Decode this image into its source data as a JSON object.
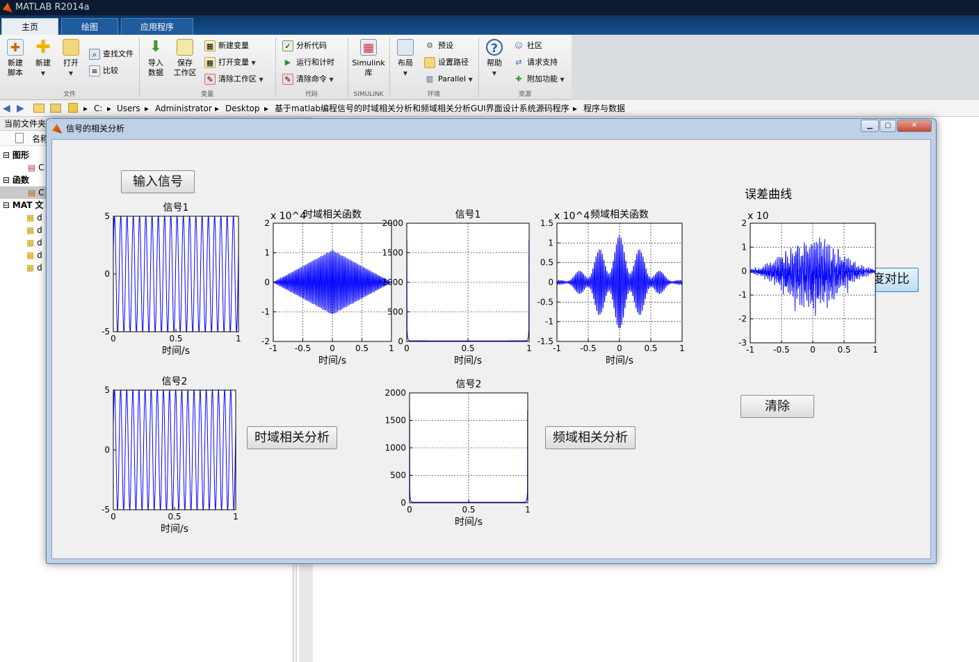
{
  "app": {
    "title": "MATLAB R2014a"
  },
  "tabs": [
    "主页",
    "绘图",
    "应用程序"
  ],
  "ribbon": {
    "file": {
      "new_script": "新建\n脚本",
      "new": "新建",
      "open": "打开",
      "find_files": "查找文件",
      "compare": "比较",
      "group": "文件"
    },
    "variable": {
      "import": "导入\n数据",
      "save_ws": "保存\n工作区",
      "new_var": "新建变量",
      "open_var": "打开变量",
      "clear_ws": "清除工作区",
      "group": "变量"
    },
    "code": {
      "analyze": "分析代码",
      "run_time": "运行和计时",
      "clear_cmd": "清除命令",
      "group": "代码"
    },
    "simulink": {
      "lib": "Simulink\n库",
      "group": "SIMULINK"
    },
    "env": {
      "layout": "布局",
      "prefs": "预设",
      "set_path": "设置路径",
      "parallel": "Parallel",
      "group": "环境"
    },
    "resources": {
      "help": "帮助",
      "community": "社区",
      "support": "请求支持",
      "addons": "附加功能",
      "group": "资源"
    }
  },
  "path": [
    "C:",
    "Users",
    "Administrator",
    "Desktop",
    "基于matlab编程信号的时域相关分析和频域相关分析GUI界面设计系统源码程序",
    "程序与数据"
  ],
  "left_panel": {
    "header": "当前文件夹",
    "col_name": "名称",
    "groups": [
      {
        "label": "图形",
        "items": [
          "C"
        ]
      },
      {
        "label": "函数",
        "items": [
          "C"
        ]
      },
      {
        "label": "MAT 文",
        "items": [
          "d",
          "d",
          "d",
          "d",
          "d"
        ]
      }
    ]
  },
  "figure": {
    "title": "信号的相关分析",
    "buttons": {
      "input": "输入信号",
      "time_corr": "时域相关分析",
      "freq_corr": "频域相关分析",
      "clear": "清除",
      "compare": "精度对比"
    },
    "error_title": "误差曲线"
  },
  "chart_data": [
    {
      "id": "sig1_time",
      "type": "line",
      "title": "信号1",
      "xlabel": "时间/s",
      "ylabel": "",
      "xlim": [
        0,
        1
      ],
      "ylim": [
        -5,
        5
      ],
      "xticks": [
        "0",
        "0.5",
        "1"
      ],
      "yticks": [
        "-5",
        "0",
        "5"
      ],
      "grid": false,
      "series": [
        {
          "kind": "sine",
          "amplitude": 5,
          "frequency": 20,
          "color": "#0000ff"
        }
      ]
    },
    {
      "id": "time_corr",
      "type": "line",
      "title": "时域相关函数",
      "multiplier": "x 10^4",
      "xlabel": "时间/s",
      "ylabel": "",
      "xlim": [
        -1,
        1
      ],
      "ylim": [
        -2,
        2
      ],
      "xticks": [
        "-1",
        "-0.5",
        "0",
        "0.5",
        "1"
      ],
      "yticks": [
        "-2",
        "-1",
        "0",
        "1",
        "2"
      ],
      "grid": true,
      "series": [
        {
          "kind": "triangle_modulated",
          "peak": 1.1,
          "frequency": 40,
          "color": "#0000ff"
        }
      ]
    },
    {
      "id": "sig1_freq",
      "type": "line",
      "title": "信号1",
      "xlabel": "时间/s",
      "ylabel": "",
      "xlim": [
        0,
        1
      ],
      "ylim": [
        0,
        2000
      ],
      "xticks": [
        "0",
        "0.5",
        "1"
      ],
      "yticks": [
        "0",
        "500",
        "1000",
        "1500",
        "2000"
      ],
      "grid": true,
      "series": [
        {
          "kind": "edge_spikes",
          "peak": 1700,
          "floor": 10,
          "color": "#0000ff"
        }
      ]
    },
    {
      "id": "freq_corr",
      "type": "line",
      "title": "频域相关函数",
      "multiplier": "x 10^4",
      "xlabel": "时间/s",
      "ylabel": "",
      "xlim": [
        -1,
        1
      ],
      "ylim": [
        -1.5,
        1.5
      ],
      "xticks": [
        "-1",
        "-0.5",
        "0",
        "0.5",
        "1"
      ],
      "yticks": [
        "-1.5",
        "-1",
        "-0.5",
        "0",
        "0.5",
        "1",
        "1.5"
      ],
      "grid": true,
      "series": [
        {
          "kind": "beat",
          "peak": 1.2,
          "frequency": 40,
          "color": "#0000ff"
        }
      ]
    },
    {
      "id": "error_curve",
      "type": "line",
      "title": "",
      "multiplier": "x 10",
      "xlabel": "",
      "ylabel": "",
      "xlim": [
        -1,
        1
      ],
      "ylim": [
        -3,
        2
      ],
      "xticks": [
        "-1",
        "-0.5",
        "0",
        "0.5",
        "1"
      ],
      "yticks": [
        "-3",
        "-2",
        "-1",
        "0",
        "1",
        "2"
      ],
      "grid": true,
      "series": [
        {
          "kind": "noise_env",
          "peak": 1.5,
          "color": "#0000ff"
        }
      ]
    },
    {
      "id": "sig2_time",
      "type": "line",
      "title": "信号2",
      "xlabel": "时间/s",
      "ylabel": "",
      "xlim": [
        0,
        1
      ],
      "ylim": [
        -5,
        5
      ],
      "xticks": [
        "0",
        "0.5",
        "1"
      ],
      "yticks": [
        "-5",
        "0",
        "5"
      ],
      "grid": false,
      "series": [
        {
          "kind": "sine",
          "amplitude": 5,
          "frequency": 20,
          "color": "#0000ff"
        }
      ]
    },
    {
      "id": "sig2_freq",
      "type": "line",
      "title": "信号2",
      "xlabel": "时间/s",
      "ylabel": "",
      "xlim": [
        0,
        1
      ],
      "ylim": [
        0,
        2000
      ],
      "xticks": [
        "0",
        "0.5",
        "1"
      ],
      "yticks": [
        "0",
        "500",
        "1000",
        "1500",
        "2000"
      ],
      "grid": true,
      "series": [
        {
          "kind": "edge_spikes",
          "peak": 1680,
          "floor": 10,
          "color": "#0000ff"
        }
      ]
    }
  ]
}
